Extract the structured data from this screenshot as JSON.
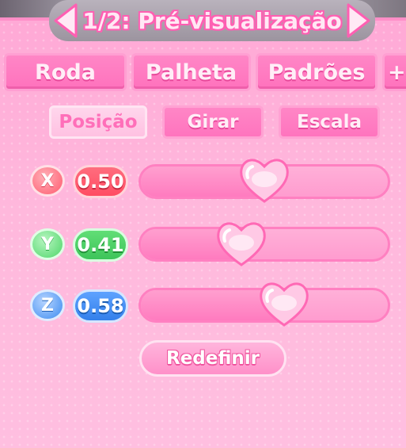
{
  "title": "1/2: Pré-visualização",
  "tabs": [
    {
      "label": "Roda"
    },
    {
      "label": "Palheta"
    },
    {
      "label": "Padrões"
    },
    {
      "label": "+"
    }
  ],
  "subtabs": [
    {
      "label": "Posição",
      "active": true
    },
    {
      "label": "Girar",
      "active": false
    },
    {
      "label": "Escala",
      "active": false
    }
  ],
  "sliders": [
    {
      "axis": "X",
      "value": "0.50",
      "fraction": 0.5,
      "color": "#ff5a6e"
    },
    {
      "axis": "Y",
      "value": "0.41",
      "fraction": 0.41,
      "color": "#4fd66a"
    },
    {
      "axis": "Z",
      "value": "0.58",
      "fraction": 0.58,
      "color": "#3d8cf0"
    }
  ],
  "reset_label": "Redefinir",
  "icons": {
    "prev": "chevron-left-icon",
    "next": "chevron-right-icon",
    "handle": "heart-icon"
  },
  "colors": {
    "accent": "#ff72bd",
    "panel": "#ffb7dc"
  }
}
